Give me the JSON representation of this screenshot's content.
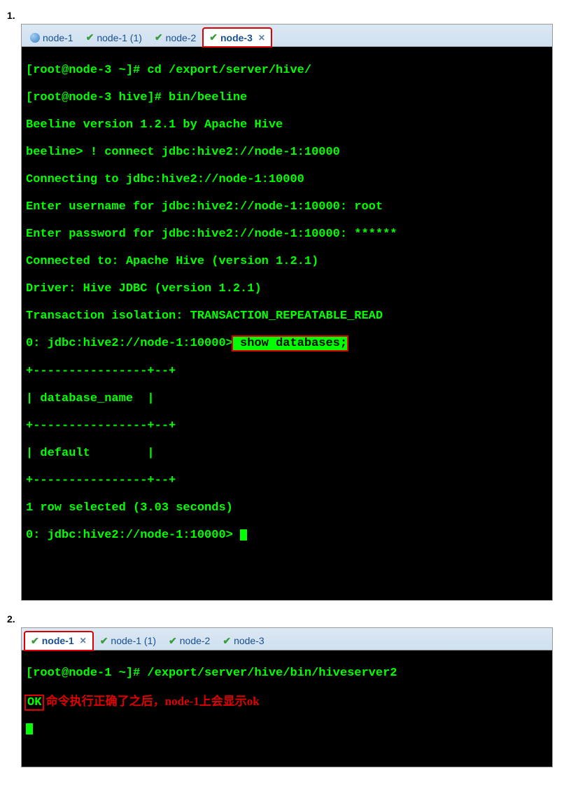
{
  "step1": {
    "label": "1.",
    "tabs": [
      {
        "label": "node-1",
        "icon": "circle",
        "active": false,
        "boxed": false,
        "closeable": false
      },
      {
        "label": "node-1 (1)",
        "icon": "check",
        "active": false,
        "boxed": false,
        "closeable": false
      },
      {
        "label": "node-2",
        "icon": "check",
        "active": false,
        "boxed": false,
        "closeable": false
      },
      {
        "label": "node-3",
        "icon": "check",
        "active": true,
        "boxed": true,
        "closeable": true
      }
    ],
    "lines": {
      "l0": "[root@node-3 ~]# cd /export/server/hive/",
      "l1": "[root@node-3 hive]# bin/beeline",
      "l2": "Beeline version 1.2.1 by Apache Hive",
      "l3": "beeline> ! connect jdbc:hive2://node-1:10000",
      "l4": "Connecting to jdbc:hive2://node-1:10000",
      "l5": "Enter username for jdbc:hive2://node-1:10000: root",
      "l6": "Enter password for jdbc:hive2://node-1:10000: ******",
      "l7": "Connected to: Apache Hive (version 1.2.1)",
      "l8": "Driver: Hive JDBC (version 1.2.1)",
      "l9": "Transaction isolation: TRANSACTION_REPEATABLE_READ",
      "l10a": "0: jdbc:hive2://node-1:10000>",
      "l10b": " show databases;",
      "l11": "+----------------+--+",
      "l12": "| database_name  |",
      "l13": "+----------------+--+",
      "l14": "| default        |",
      "l15": "+----------------+--+",
      "l16": "1 row selected (3.03 seconds)",
      "l17": "0: jdbc:hive2://node-1:10000> "
    }
  },
  "step2": {
    "label": "2.",
    "tabs": [
      {
        "label": "node-1",
        "icon": "check",
        "active": true,
        "boxed": true,
        "closeable": true
      },
      {
        "label": "node-1 (1)",
        "icon": "check",
        "active": false,
        "boxed": false,
        "closeable": false
      },
      {
        "label": "node-2",
        "icon": "check",
        "active": false,
        "boxed": false,
        "closeable": false
      },
      {
        "label": "node-3",
        "icon": "check",
        "active": false,
        "boxed": false,
        "closeable": false
      }
    ],
    "lines": {
      "l0": "[root@node-1 ~]# /export/server/hive/bin/hiveserver2",
      "l1a": "OK",
      "l1b": " 命令执行正确了之后，node-1上会显示ok"
    }
  }
}
